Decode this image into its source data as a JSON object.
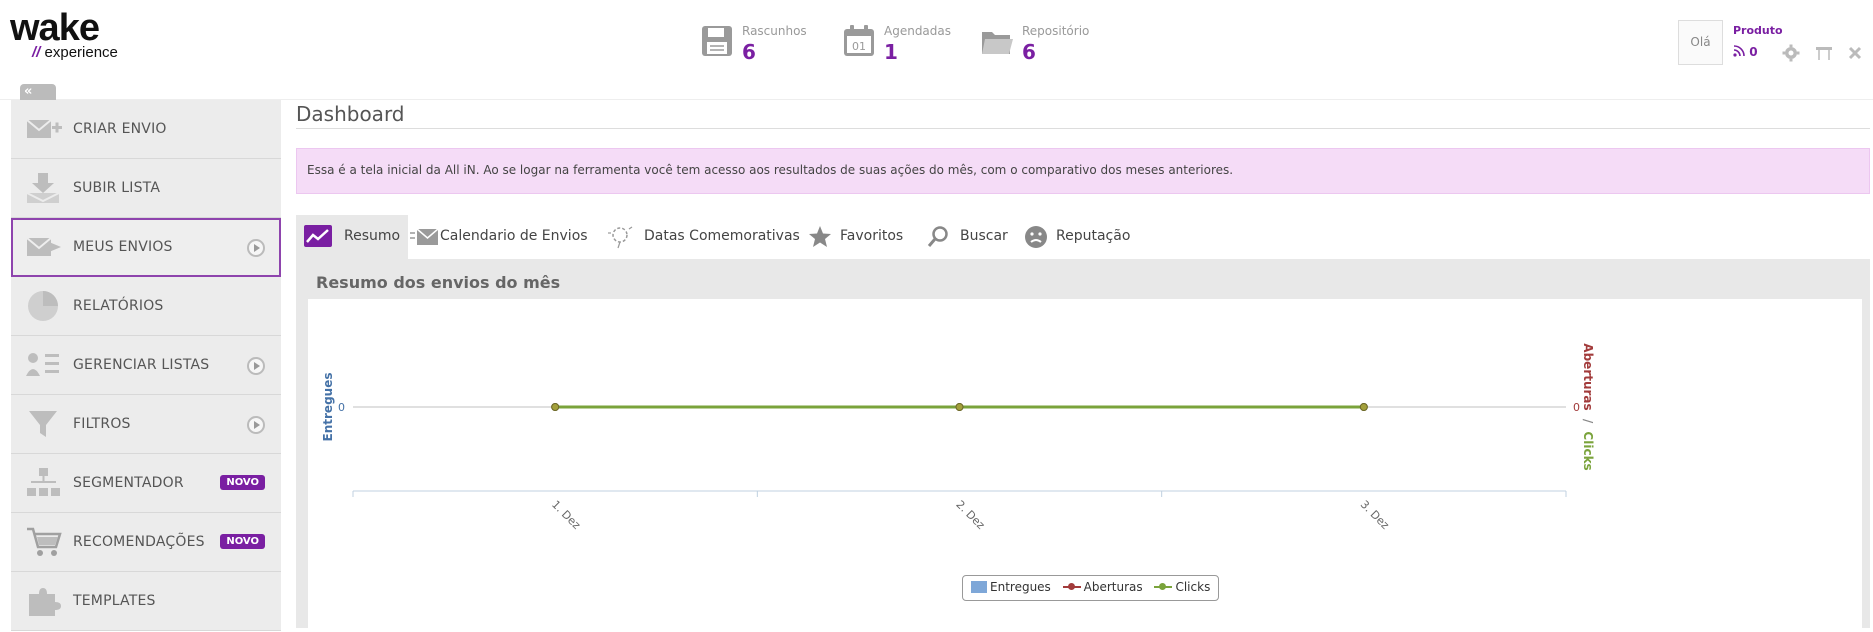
{
  "logo": {
    "main": "wake",
    "slash": "//",
    "sub": "experience"
  },
  "header": {
    "stats": [
      {
        "label": "Rascunhos",
        "value": "6",
        "icon": "floppy-disk-icon"
      },
      {
        "label": "Agendadas",
        "value": "1",
        "icon": "calendar-icon",
        "calendar_text": "01"
      },
      {
        "label": "Repositório",
        "value": "6",
        "icon": "folder-icon"
      }
    ],
    "user_greeting": "Olá",
    "user_name": "Produto",
    "feed_count": "0",
    "collapse_label": "«"
  },
  "sidebar": {
    "items": [
      {
        "label": "CRIAR ENVIO",
        "icon": "create-send-icon"
      },
      {
        "label": "SUBIR LISTA",
        "icon": "upload-list-icon"
      },
      {
        "label": "MEUS ENVIOS",
        "icon": "my-sends-icon",
        "active": true,
        "expand": true
      },
      {
        "label": "RELATÓRIOS",
        "icon": "pie-chart-icon"
      },
      {
        "label": "GERENCIAR LISTAS",
        "icon": "manage-lists-icon",
        "expand": true
      },
      {
        "label": "FILTROS",
        "icon": "funnel-icon",
        "expand": true
      },
      {
        "label": "SEGMENTADOR",
        "icon": "segmenter-icon",
        "badge": "NOVO"
      },
      {
        "label": "RECOMENDAÇÕES",
        "icon": "cart-icon",
        "badge": "NOVO"
      },
      {
        "label": "TEMPLATES",
        "icon": "puzzle-icon"
      }
    ]
  },
  "main": {
    "title": "Dashboard",
    "info": "Essa é a tela inicial da All iN. Ao se logar na ferramenta você tem acesso aos resultados de suas ações do mês, com o comparativo dos meses anteriores.",
    "tabs": [
      {
        "label": "Resumo",
        "icon": "trend-icon"
      },
      {
        "label": "Calendario de Envios",
        "icon": "envelope-icon"
      },
      {
        "label": "Datas Comemorativas",
        "icon": "balloon-icon"
      },
      {
        "label": "Favoritos",
        "icon": "star-icon"
      },
      {
        "label": "Buscar",
        "icon": "magnifier-icon"
      },
      {
        "label": "Reputação",
        "icon": "face-icon"
      }
    ],
    "panel_title": "Resumo dos envios do mês"
  },
  "colors": {
    "accent": "#7a1fa2",
    "entregues": "#7ea7d8",
    "aberturas": "#a23b3b",
    "clicks": "#7aa33b"
  },
  "chart_data": {
    "type": "line",
    "categories": [
      "1. Dez",
      "2. Dez",
      "3. Dez"
    ],
    "series": [
      {
        "name": "Entregues",
        "values": [
          0,
          0,
          0
        ]
      },
      {
        "name": "Aberturas",
        "values": [
          0,
          0,
          0
        ]
      },
      {
        "name": "Clicks",
        "values": [
          0,
          0,
          0
        ]
      }
    ],
    "ylabel_left": "Entregues",
    "ylabel_right_1": "Aberturas",
    "ylabel_right_sep": "/",
    "ylabel_right_2": "Clicks",
    "ytick_left": "0",
    "ytick_right": "0",
    "legend": "bottom-center"
  }
}
